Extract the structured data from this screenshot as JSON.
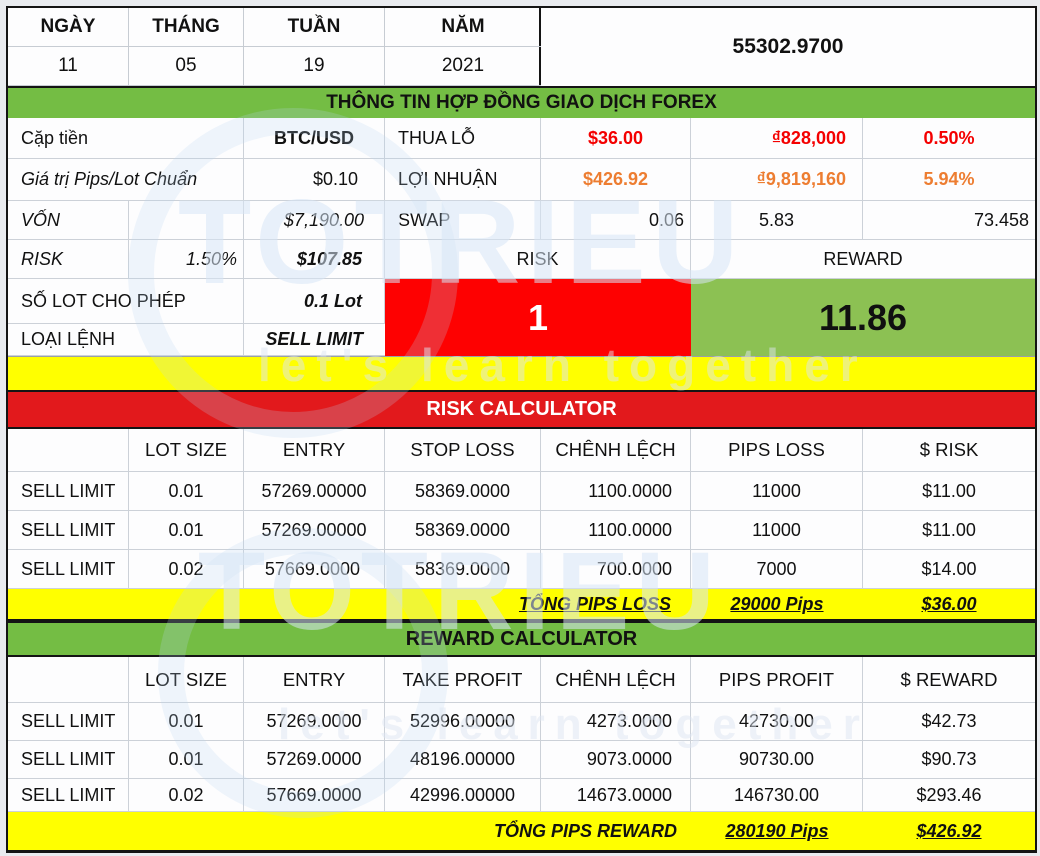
{
  "date_panel": {
    "headers": [
      "NGÀY",
      "THÁNG",
      "TUẦN",
      "NĂM"
    ],
    "values": [
      "11",
      "05",
      "19",
      "2021"
    ],
    "quote_price": "55302.9700"
  },
  "contract": {
    "title": "THÔNG TIN HỢP ĐỒNG GIAO DỊCH FOREX",
    "pair_label": "Cặp tiền",
    "pair_value": "BTC/USD",
    "loss_label": "THUA LỖ",
    "loss_usd": "$36.00",
    "loss_vnd": "₫828,000",
    "loss_pct": "0.50%",
    "pip_value_label": "Giá trị Pips/Lot Chuẩn",
    "pip_value": "$0.10",
    "profit_label": "LỢI NHUẬN",
    "profit_usd": "$426.92",
    "profit_vnd": "₫9,819,160",
    "profit_pct": "5.94%",
    "capital_label": "VỐN",
    "capital_value": "$7,190.00",
    "swap_label": "SWAP",
    "swap_value_1": "0.06",
    "swap_value_2": "5.83",
    "swap_value_3": "73.458",
    "risk_label": "RISK",
    "risk_pct": "1.50%",
    "risk_amount": "$107.85",
    "lot_allowed_label": "SỐ LOT CHO PHÉP",
    "lot_allowed_value": "0.1 Lot",
    "order_type_label": "LOẠI LỆNH",
    "order_type_value": "SELL LIMIT"
  },
  "rr_summary": {
    "risk_label": "RISK",
    "reward_label": "REWARD",
    "risk_ratio": "1",
    "reward_ratio": "11.86"
  },
  "risk_calc": {
    "title": "RISK CALCULATOR",
    "headers": [
      "",
      "LOT SIZE",
      "ENTRY",
      "STOP LOSS",
      "CHÊNH LỆCH",
      "PIPS LOSS",
      "$ RISK"
    ],
    "rows": [
      [
        "SELL LIMIT",
        "0.01",
        "57269.00000",
        "58369.0000",
        "1100.0000",
        "11000",
        "$11.00"
      ],
      [
        "SELL LIMIT",
        "0.01",
        "57269.00000",
        "58369.0000",
        "1100.0000",
        "11000",
        "$11.00"
      ],
      [
        "SELL LIMIT",
        "0.02",
        "57669.0000",
        "58369.0000",
        "700.0000",
        "7000",
        "$14.00"
      ]
    ],
    "total_label": "TỔNG PIPS LOSS",
    "total_pips": "29000 Pips",
    "total_amount": "$36.00"
  },
  "reward_calc": {
    "title": "REWARD CALCULATOR",
    "headers": [
      "",
      "LOT SIZE",
      "ENTRY",
      "TAKE PROFIT",
      "CHÊNH LỆCH",
      "PIPS PROFIT",
      "$ REWARD"
    ],
    "rows": [
      [
        "SELL LIMIT",
        "0.01",
        "57269.0000",
        "52996.00000",
        "4273.0000",
        "42730.00",
        "$42.73"
      ],
      [
        "SELL LIMIT",
        "0.01",
        "57269.0000",
        "48196.00000",
        "9073.0000",
        "90730.00",
        "$90.73"
      ],
      [
        "SELL LIMIT",
        "0.02",
        "57669.0000",
        "42996.00000",
        "14673.0000",
        "146730.00",
        "$293.46"
      ]
    ],
    "total_label": "TỔNG PIPS REWARD",
    "total_pips": "280190 Pips",
    "total_amount": "$426.92"
  },
  "watermark": {
    "brand": "TOTRIEU",
    "tagline": "let's learn together"
  },
  "colors": {
    "band_green": "#74bd44",
    "band_red": "#e2191c",
    "band_yellow": "#ffff00",
    "risk_box_red": "#fe0101",
    "reward_box_green": "#8cc153",
    "loss_text_red": "#f40000",
    "profit_text_orange": "#ed7d31"
  }
}
